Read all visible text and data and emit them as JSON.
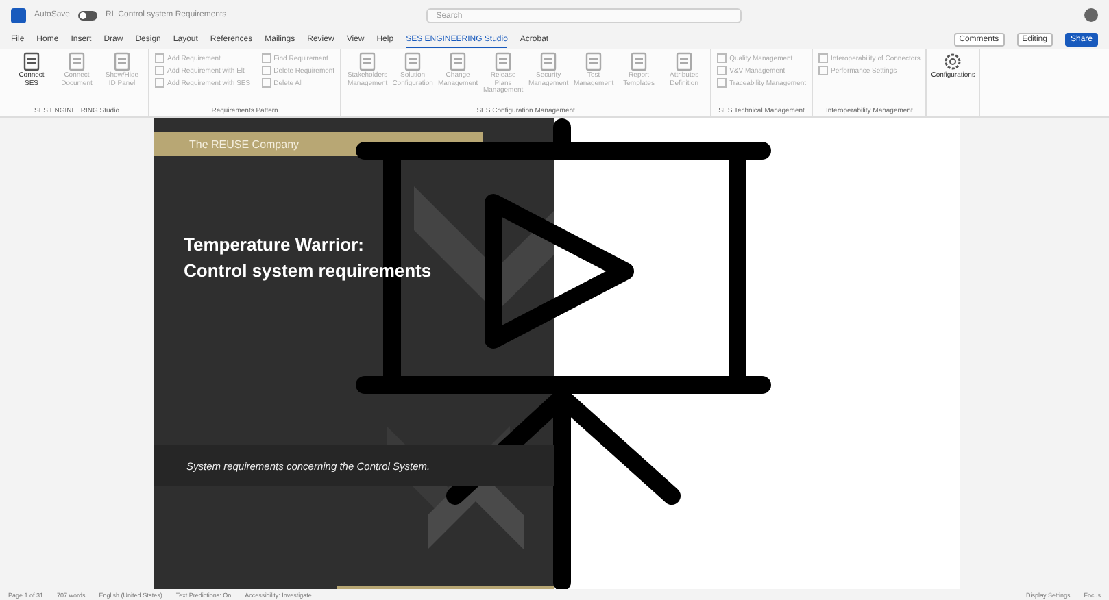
{
  "window": {
    "autosave_label": "AutoSave",
    "autosave_on": false,
    "title": "RL Control system Requirements",
    "search_placeholder": "Search"
  },
  "tabs": [
    {
      "label": "File",
      "selected": false
    },
    {
      "label": "Home",
      "selected": false
    },
    {
      "label": "Insert",
      "selected": false
    },
    {
      "label": "Draw",
      "selected": false
    },
    {
      "label": "Design",
      "selected": false
    },
    {
      "label": "Layout",
      "selected": false
    },
    {
      "label": "References",
      "selected": false
    },
    {
      "label": "Mailings",
      "selected": false
    },
    {
      "label": "Review",
      "selected": false
    },
    {
      "label": "View",
      "selected": false
    },
    {
      "label": "Help",
      "selected": false
    },
    {
      "label": "SES ENGINEERING Studio",
      "selected": true
    },
    {
      "label": "Acrobat",
      "selected": false
    }
  ],
  "top_actions": [
    "Comments",
    "Editing",
    "Share"
  ],
  "ribbon_groups": [
    {
      "name": "SES ENGINEERING Studio",
      "items": [
        {
          "kind": "large",
          "label": "Connect SES",
          "disabled": false
        },
        {
          "kind": "large",
          "label": "Connect Document",
          "disabled": true
        },
        {
          "kind": "large",
          "label": "Show/Hide ID Panel",
          "disabled": true
        }
      ]
    },
    {
      "name": "Requirements Pattern",
      "items": [
        {
          "kind": "small",
          "label": "Add Requirement",
          "disabled": true
        },
        {
          "kind": "small",
          "label": "Add Requirement with Elt",
          "disabled": true
        },
        {
          "kind": "small",
          "label": "Add Requirement with SES",
          "disabled": true
        },
        {
          "kind": "small",
          "label": "Find Requirement",
          "disabled": true
        },
        {
          "kind": "small",
          "label": "Delete Requirement",
          "disabled": true
        },
        {
          "kind": "small",
          "label": "Delete All",
          "disabled": true
        }
      ]
    },
    {
      "name": "SES Configuration Management",
      "items": [
        {
          "kind": "large",
          "label": "Stakeholders Management",
          "disabled": true
        },
        {
          "kind": "large",
          "label": "Solution Configuration",
          "disabled": true
        },
        {
          "kind": "large",
          "label": "Change Management",
          "disabled": true
        },
        {
          "kind": "large",
          "label": "Release Plans Management",
          "disabled": true
        },
        {
          "kind": "large",
          "label": "Security Management",
          "disabled": true
        },
        {
          "kind": "large",
          "label": "Test Management",
          "disabled": true
        },
        {
          "kind": "large",
          "label": "Report Templates",
          "disabled": true
        },
        {
          "kind": "large",
          "label": "Attributes Definition",
          "disabled": true
        }
      ]
    },
    {
      "name": "SES Technical Management",
      "items": [
        {
          "kind": "small",
          "label": "Quality Management",
          "disabled": true
        },
        {
          "kind": "small",
          "label": "V&V Management",
          "disabled": true
        },
        {
          "kind": "small",
          "label": "Traceability Management",
          "disabled": true
        }
      ]
    },
    {
      "name": "Interoperability Management",
      "items": [
        {
          "kind": "small",
          "label": "Interoperability of Connectors",
          "disabled": true
        },
        {
          "kind": "small",
          "label": "Performance Settings",
          "disabled": true
        }
      ]
    },
    {
      "items": [
        {
          "kind": "large",
          "label": "Configurations",
          "disabled": false
        }
      ]
    }
  ],
  "document": {
    "company": "The REUSE Company",
    "title_lines": [
      "Temperature Warrior:",
      "Control system requirements"
    ],
    "subtitle": "System requirements concerning the Control System."
  },
  "status_bar": {
    "left": [
      "Page 1 of 31",
      "707 words",
      "English (United States)",
      "Text Predictions: On",
      "Accessibility: Investigate"
    ],
    "right": [
      "Display Settings",
      "Focus"
    ]
  }
}
